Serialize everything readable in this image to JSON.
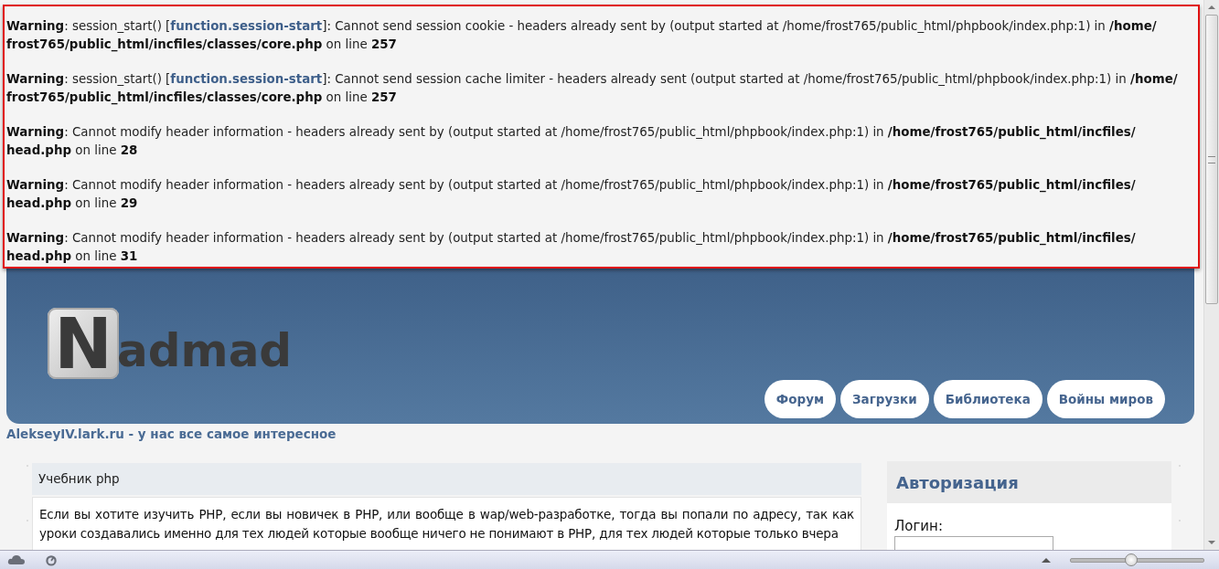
{
  "warnings": [
    {
      "head": "**Warning**: session_start() [",
      "link": "function.session-start",
      "line1": "]: Cannot send session cookie - headers already sent by (output started at /home/frost765/public_html/phpbook/index.php:1) in **/home/**",
      "line2": "**frost765/public_html/incfiles/classes/core.php** on line **257**"
    },
    {
      "head": "**Warning**: session_start() [",
      "link": "function.session-start",
      "line1": "]: Cannot send session cache limiter - headers already sent (output started at /home/frost765/public_html/phpbook/index.php:1) in **/home/**",
      "line2": "**frost765/public_html/incfiles/classes/core.php** on line **257**"
    },
    {
      "line1": "**Warning**: Cannot modify header information - headers already sent by (output started at /home/frost765/public_html/phpbook/index.php:1) in **/home/frost765/public_html/incfiles/**",
      "line2": "**head.php** on line **28**"
    },
    {
      "line1": "**Warning**: Cannot modify header information - headers already sent by (output started at /home/frost765/public_html/phpbook/index.php:1) in **/home/frost765/public_html/incfiles/**",
      "line2": "**head.php** on line **29**"
    },
    {
      "line1": "**Warning**: Cannot modify header information - headers already sent by (output started at /home/frost765/public_html/phpbook/index.php:1) in **/home/frost765/public_html/incfiles/**",
      "line2": "**head.php** on line **31**"
    }
  ],
  "logo": {
    "initial": "N",
    "rest": "admad"
  },
  "nav": [
    "Форум",
    "Загрузки",
    "Библиотека",
    "Войны миров"
  ],
  "tagline": {
    "link": "AlekseyIV.lark.ru",
    "text": " - у нас все самое интересное"
  },
  "article": {
    "title": "Учебник php",
    "body": "Если вы хотите изучить PHP, если вы новичек в PHP, или вообще в wap/web-разработке, тогда вы попали по адресу, так как уроки создавались именно для тех людей которые вообще ничего не понимают в PHP, для тех людей которые только вчера"
  },
  "auth": {
    "title": "Авторизация",
    "login_label": "Логин:"
  },
  "status_bar": {
    "zoom": {
      "level": 0.45
    }
  }
}
